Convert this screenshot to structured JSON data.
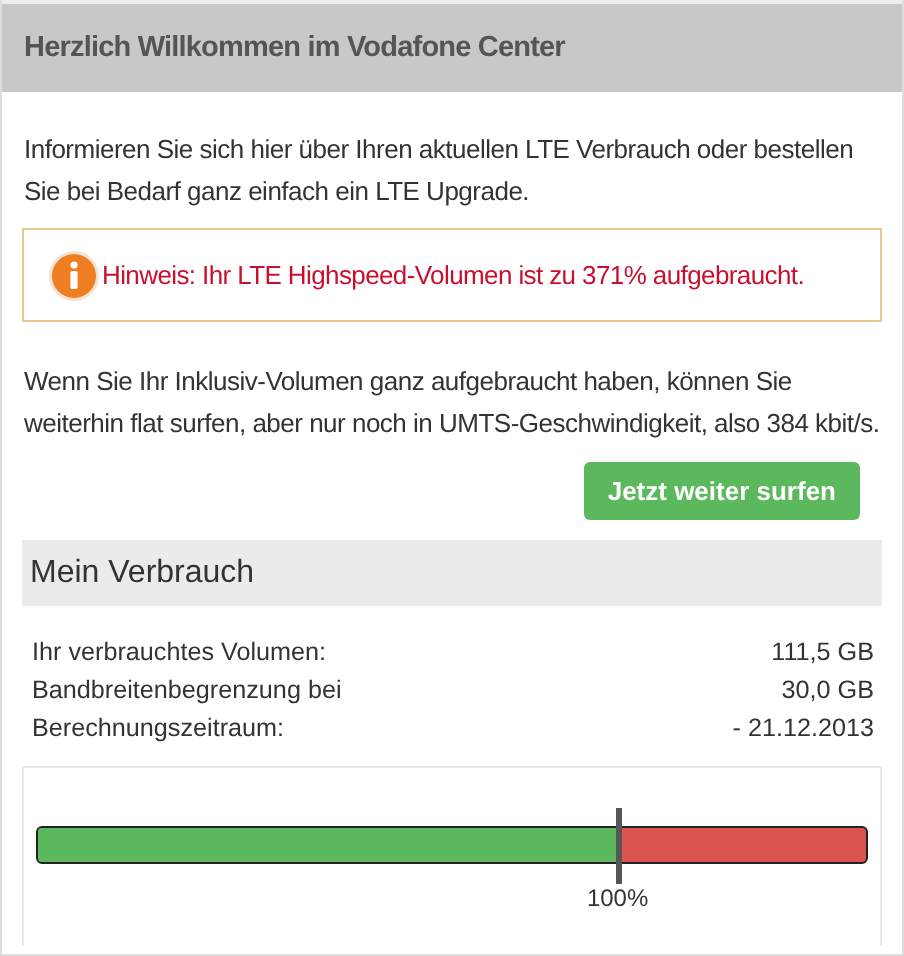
{
  "header": {
    "title": "Herzlich Willkommen im Vodafone Center"
  },
  "intro": "Informieren Sie sich hier über Ihren aktuellen LTE Verbrauch oder bestellen Sie bei Bedarf ganz einfach ein LTE Upgrade.",
  "notice": {
    "text": "Hinweis: Ihr LTE Highspeed-Volumen ist zu 371% aufgebraucht."
  },
  "info": "Wenn Sie Ihr Inklusiv-Volumen ganz aufgebraucht haben, können Sie weiterhin flat surfen, aber nur noch in UMTS-Geschwindigkeit, also 384 kbit/s.",
  "button": "Jetzt weiter surfen",
  "usage": {
    "title": "Mein Verbrauch",
    "rows": [
      {
        "label": "Ihr verbrauchtes Volumen:",
        "value": "111,5 GB"
      },
      {
        "label": "Bandbreitenbegrenzung bei",
        "value": "30,0 GB"
      },
      {
        "label": "Berechnungszeitraum:",
        "value": "- 21.12.2013"
      }
    ],
    "meter": {
      "level": 0.7,
      "marker_label": "100%"
    }
  }
}
